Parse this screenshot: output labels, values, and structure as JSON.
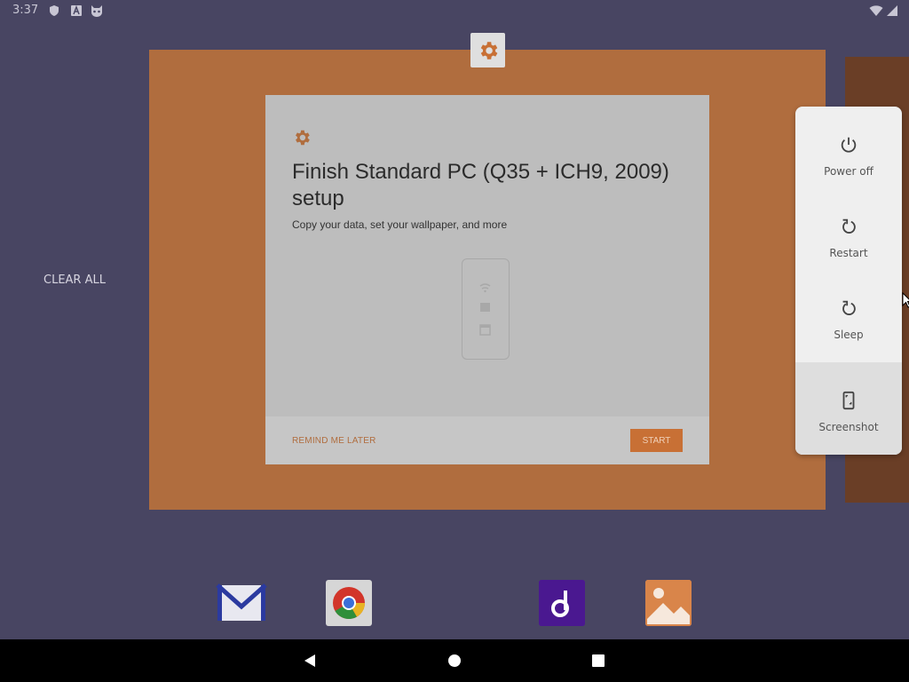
{
  "status_bar": {
    "time": "3:37",
    "icons": [
      "shield-icon",
      "a-notification-icon",
      "cat-notification-icon",
      "wifi-icon"
    ]
  },
  "recents": {
    "clear_all": "CLEAR ALL",
    "app_icon": "settings-gear-icon"
  },
  "setup_card": {
    "title": "Finish Standard PC (Q35 + ICH9, 2009) setup",
    "subtitle": "Copy your data, set your wallpaper, and more",
    "remind_label": "REMIND ME LATER",
    "start_label": "START",
    "accent_color": "#c87035"
  },
  "power_menu": {
    "items": [
      {
        "label": "Power off",
        "icon": "power-icon"
      },
      {
        "label": "Restart",
        "icon": "restart-icon"
      },
      {
        "label": "Sleep",
        "icon": "sleep-icon"
      },
      {
        "label": "Screenshot",
        "icon": "screenshot-icon"
      }
    ]
  },
  "dock": [
    "email-app-icon",
    "chrome-app-icon",
    "music-app-icon",
    "gallery-app-icon"
  ],
  "nav_bar": [
    "back-button",
    "home-button",
    "recents-button"
  ]
}
